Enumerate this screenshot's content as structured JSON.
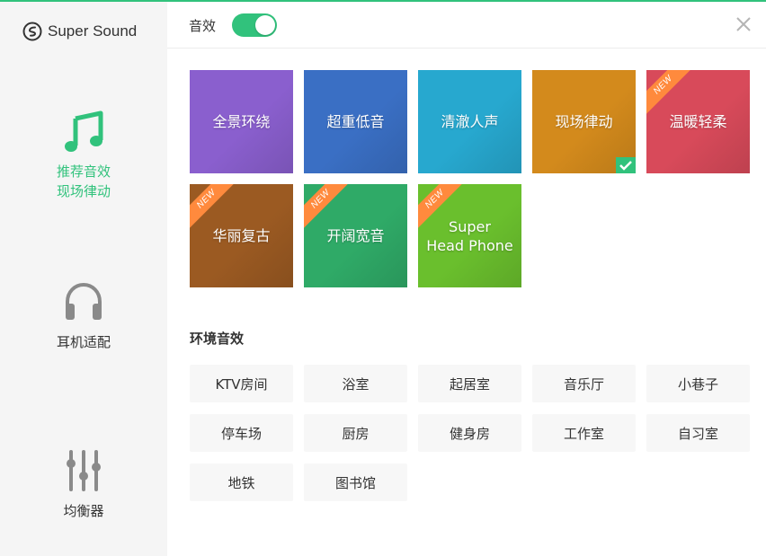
{
  "brand": {
    "name": "Super Sound"
  },
  "colors": {
    "accent": "#31c27c",
    "ribbon": "#ff8a3d",
    "sidebar_bg": "#f5f5f5"
  },
  "sidebar": {
    "items": [
      {
        "label": "推荐音效",
        "sub": "现场律动",
        "icon": "music-note-icon",
        "active": true
      },
      {
        "label": "耳机适配",
        "icon": "headphones-icon",
        "active": false
      },
      {
        "label": "均衡器",
        "icon": "equalizer-icon",
        "active": false
      }
    ]
  },
  "header": {
    "effect_label": "音效",
    "effect_enabled": true,
    "close_icon": "close-icon"
  },
  "presets": [
    {
      "label": "全景环绕",
      "color": "#8a5fce",
      "new": false,
      "selected": false
    },
    {
      "label": "超重低音",
      "color": "#3a6fc4",
      "new": false,
      "selected": false
    },
    {
      "label": "清澈人声",
      "color": "#27a8cf",
      "new": false,
      "selected": false
    },
    {
      "label": "现场律动",
      "color": "#d38a1c",
      "new": false,
      "selected": true
    },
    {
      "label": "温暖轻柔",
      "color": "#d84a5a",
      "new": true,
      "selected": false
    },
    {
      "label": "华丽复古",
      "color": "#9b5a22",
      "new": true,
      "selected": false
    },
    {
      "label": "开阔宽音",
      "color": "#2faa67",
      "new": true,
      "selected": false
    },
    {
      "label": "Super\nHead Phone",
      "color": "#6abf2d",
      "new": true,
      "selected": false
    }
  ],
  "new_badge": "NEW",
  "environment": {
    "title": "环境音效",
    "items": [
      "KTV房间",
      "浴室",
      "起居室",
      "音乐厅",
      "小巷子",
      "停车场",
      "厨房",
      "健身房",
      "工作室",
      "自习室",
      "地铁",
      "图书馆"
    ]
  }
}
